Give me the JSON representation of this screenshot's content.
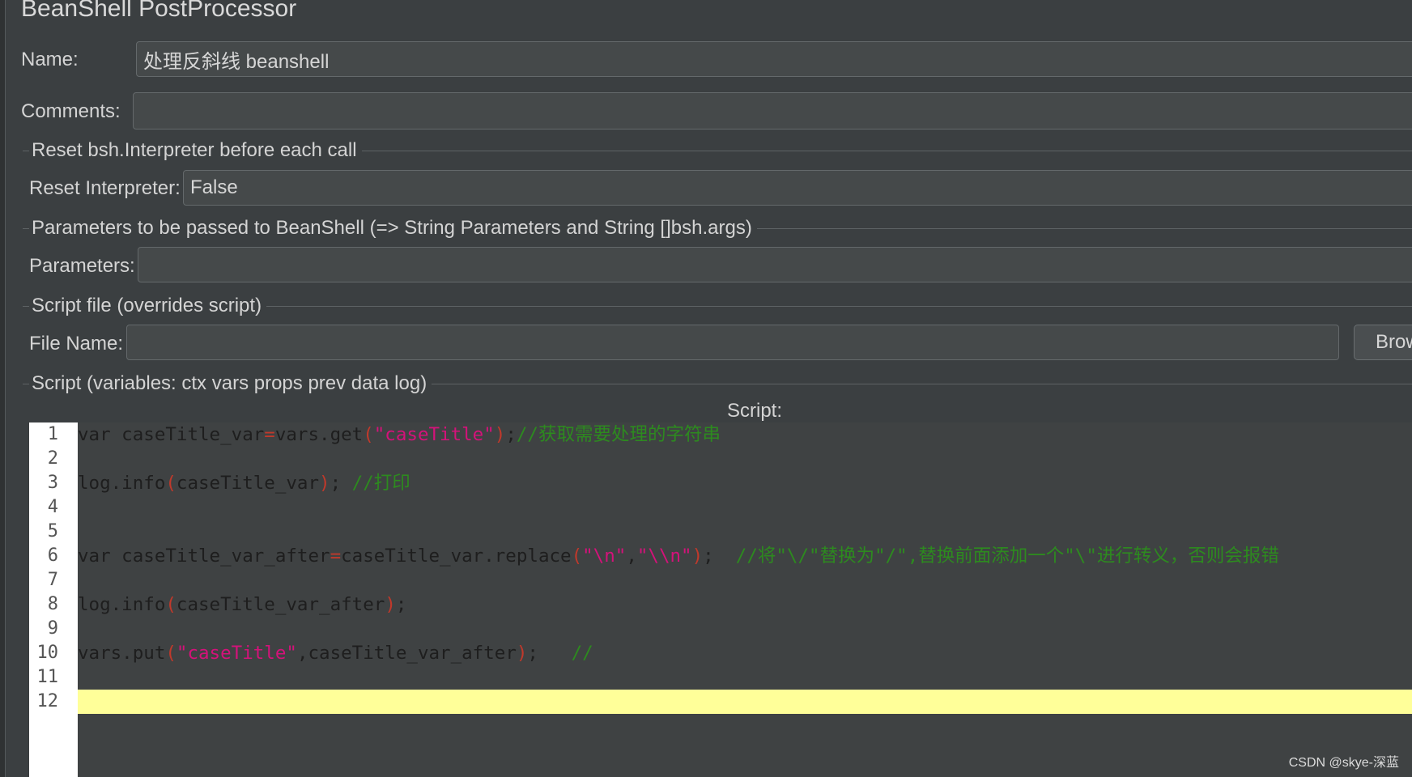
{
  "panel": {
    "title": "BeanShell PostProcessor",
    "name_label": "Name:",
    "name_value": "处理反斜线 beanshell",
    "comments_label": "Comments:",
    "comments_value": ""
  },
  "reset_section": {
    "heading": "Reset bsh.Interpreter before each call",
    "label": "Reset Interpreter:",
    "value": "False"
  },
  "params_section": {
    "heading": "Parameters to be passed to BeanShell (=> String Parameters and String []bsh.args)",
    "label": "Parameters:",
    "value": ""
  },
  "file_section": {
    "heading": "Script file (overrides script)",
    "label": "File Name:",
    "value": "",
    "browse_label": "Browse..."
  },
  "script_section": {
    "heading": "Script (variables: ctx vars props prev data log)",
    "editor_title": "Script:"
  },
  "editor": {
    "line_numbers": [
      "1",
      "2",
      "3",
      "4",
      "5",
      "6",
      "7",
      "8",
      "9",
      "10",
      "11",
      "12"
    ],
    "highlight_color": "#ffff99",
    "syntax_colors": {
      "operator": "#c0392b",
      "string": "#d4127a",
      "comment": "#2d8a1f",
      "text": "#1e1e1e"
    },
    "lines": [
      [
        {
          "t": "var caseTitle_var"
        },
        {
          "t": "=",
          "c": "op"
        },
        {
          "t": "vars.get"
        },
        {
          "t": "(",
          "c": "op"
        },
        {
          "t": "\"caseTitle\"",
          "c": "str"
        },
        {
          "t": ")",
          "c": "op"
        },
        {
          "t": ";"
        },
        {
          "t": "//获取需要处理的字符串",
          "c": "cmt"
        }
      ],
      [],
      [
        {
          "t": "log.info"
        },
        {
          "t": "(",
          "c": "op"
        },
        {
          "t": "caseTitle_var"
        },
        {
          "t": ")",
          "c": "op"
        },
        {
          "t": "; "
        },
        {
          "t": "//打印",
          "c": "cmt"
        }
      ],
      [],
      [],
      [
        {
          "t": "var caseTitle_var_after"
        },
        {
          "t": "=",
          "c": "op"
        },
        {
          "t": "caseTitle_var.replace"
        },
        {
          "t": "(",
          "c": "op"
        },
        {
          "t": "\"\\n\"",
          "c": "str"
        },
        {
          "t": ","
        },
        {
          "t": "\"\\\\n\"",
          "c": "str"
        },
        {
          "t": ")",
          "c": "op"
        },
        {
          "t": ";  "
        },
        {
          "t": "//将\"\\/\"替换为\"/\",替换前面添加一个\"\\\"进行转义，否则会报错",
          "c": "cmt"
        }
      ],
      [],
      [
        {
          "t": "log.info"
        },
        {
          "t": "(",
          "c": "op"
        },
        {
          "t": "caseTitle_var_after"
        },
        {
          "t": ")",
          "c": "op"
        },
        {
          "t": ";"
        }
      ],
      [],
      [
        {
          "t": "vars.put"
        },
        {
          "t": "(",
          "c": "op"
        },
        {
          "t": "\"caseTitle\"",
          "c": "str"
        },
        {
          "t": ",caseTitle_var_after"
        },
        {
          "t": ")",
          "c": "op"
        },
        {
          "t": ";   "
        },
        {
          "t": "//",
          "c": "cmt"
        }
      ],
      [],
      []
    ]
  },
  "watermark": "CSDN @skye-深蓝"
}
